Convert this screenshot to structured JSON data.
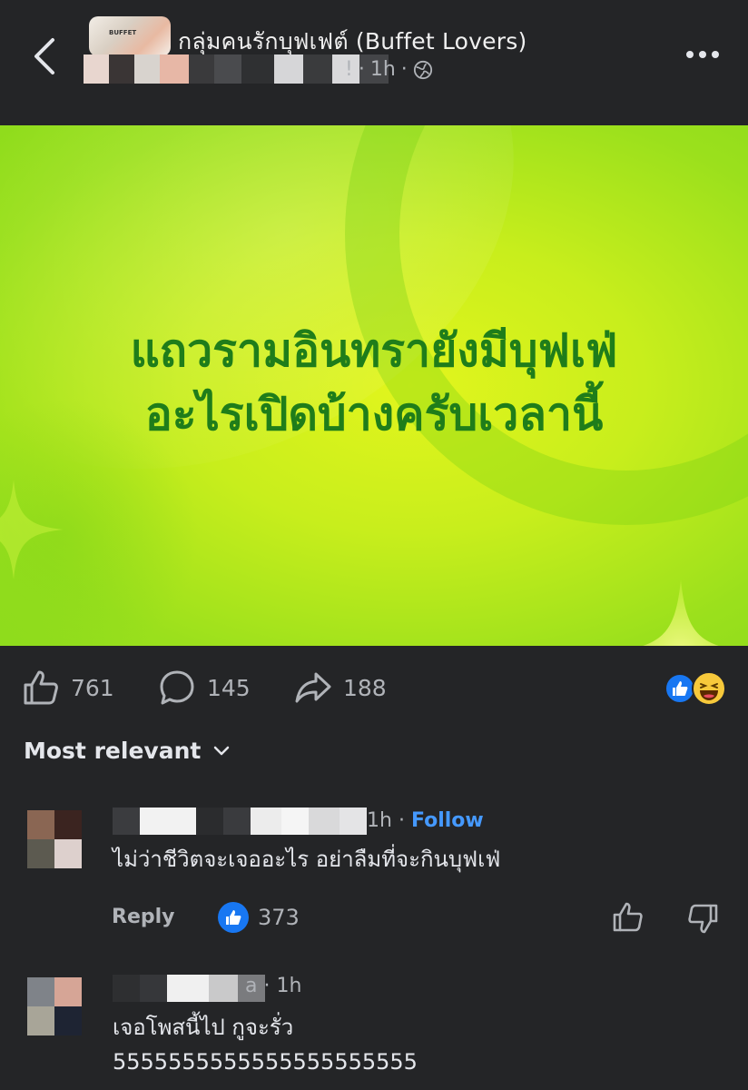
{
  "header": {
    "group_name": "กลุ่มคนรักบุฟเฟต์ (Buffet Lovers)",
    "avatar_tag": "BUFFET",
    "time": "1h",
    "separator": "·",
    "author_fragment": "!"
  },
  "post": {
    "image_text_line1": "แถวรามอินทรายังมีบุฟเฟ่",
    "image_text_line2": "อะไรเปิดบ้างครับเวลานี้",
    "text_color": "#1f7d1a"
  },
  "actions": {
    "like_count": "761",
    "comment_count": "145",
    "share_count": "188",
    "reaction_icons": [
      "like-icon",
      "haha-emoji-icon"
    ]
  },
  "sort": {
    "label": "Most relevant"
  },
  "comments": [
    {
      "time": "1h",
      "follow_label": "Follow",
      "text": "ไม่ว่าชีวิตจะเจออะไร อย่าลืมที่จะกินบุฟเฟ่",
      "reply_label": "Reply",
      "like_count": "373"
    },
    {
      "name_fragment": "a",
      "time": "1h",
      "text_line1": "เจอโพสนี้ไป กูจะรั่ว",
      "text_line2": "5555555555555555555555"
    }
  ],
  "colors": {
    "background": "#242527",
    "accent_blue": "#1877f2",
    "follow_blue": "#4599ff",
    "muted_text": "#b0b3b8"
  }
}
